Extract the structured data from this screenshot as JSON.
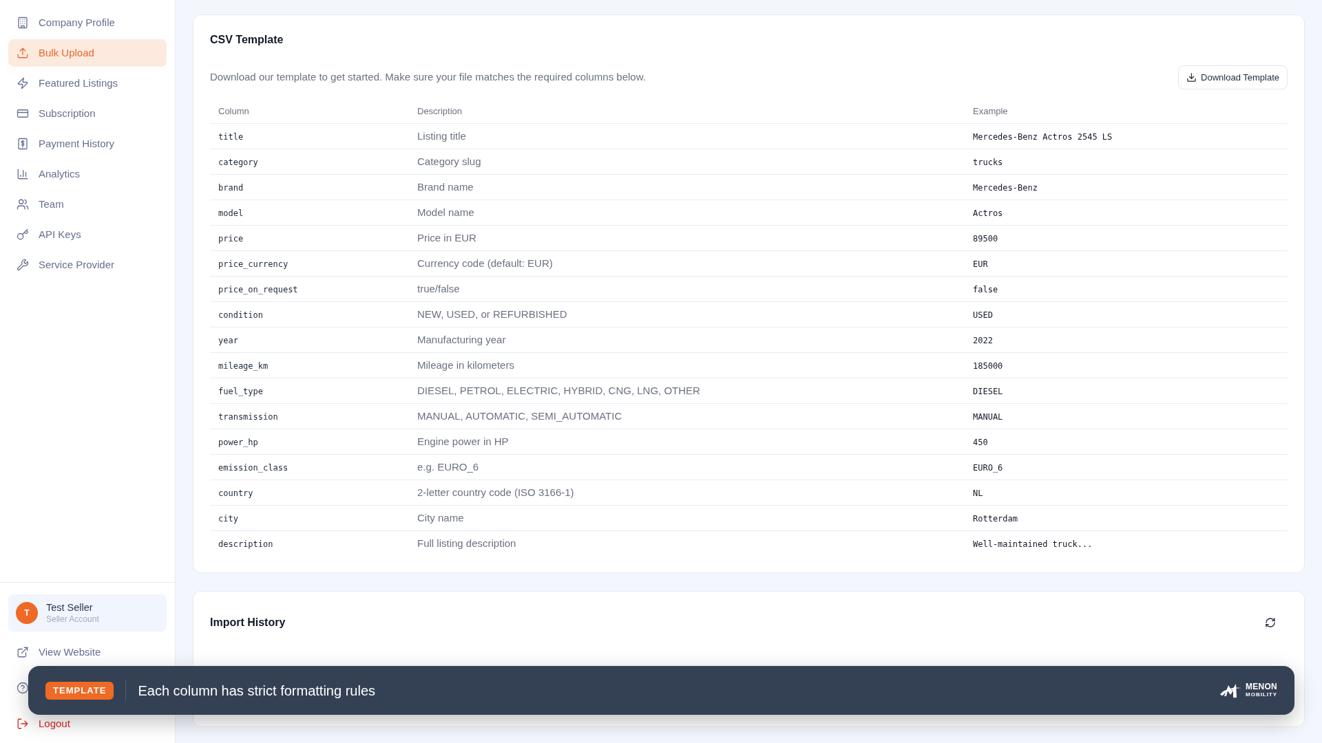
{
  "sidebar": {
    "items": [
      {
        "label": "Company Profile",
        "selected": false
      },
      {
        "label": "Bulk Upload",
        "selected": true
      },
      {
        "label": "Featured Listings",
        "selected": false
      },
      {
        "label": "Subscription",
        "selected": false
      },
      {
        "label": "Payment History",
        "selected": false
      },
      {
        "label": "Analytics",
        "selected": false
      },
      {
        "label": "Team",
        "selected": false
      },
      {
        "label": "API Keys",
        "selected": false
      },
      {
        "label": "Service Provider",
        "selected": false
      }
    ],
    "user": {
      "initial": "T",
      "name": "Test Seller",
      "role": "Seller Account"
    },
    "footer_items": [
      {
        "label": "View Website",
        "kind": "link"
      },
      {
        "kind": "covered"
      },
      {
        "label": "Logout",
        "kind": "danger"
      }
    ]
  },
  "csv_template": {
    "title": "CSV Template",
    "description": "Download our template to get started. Make sure your file matches the required columns below.",
    "download_button": "Download Template",
    "table": {
      "columns": [
        "Column",
        "Description",
        "Example"
      ],
      "rows": [
        {
          "column": "title",
          "description": "Listing title",
          "example": "Mercedes-Benz Actros 2545 LS"
        },
        {
          "column": "category",
          "description": "Category slug",
          "example": "trucks"
        },
        {
          "column": "brand",
          "description": "Brand name",
          "example": "Mercedes-Benz"
        },
        {
          "column": "model",
          "description": "Model name",
          "example": "Actros"
        },
        {
          "column": "price",
          "description": "Price in EUR",
          "example": "89500"
        },
        {
          "column": "price_currency",
          "description": "Currency code (default: EUR)",
          "example": "EUR"
        },
        {
          "column": "price_on_request",
          "description": "true/false",
          "example": "false"
        },
        {
          "column": "condition",
          "description": "NEW, USED, or REFURBISHED",
          "example": "USED"
        },
        {
          "column": "year",
          "description": "Manufacturing year",
          "example": "2022"
        },
        {
          "column": "mileage_km",
          "description": "Mileage in kilometers",
          "example": "185000"
        },
        {
          "column": "fuel_type",
          "description": "DIESEL, PETROL, ELECTRIC, HYBRID, CNG, LNG, OTHER",
          "example": "DIESEL"
        },
        {
          "column": "transmission",
          "description": "MANUAL, AUTOMATIC, SEMI_AUTOMATIC",
          "example": "MANUAL"
        },
        {
          "column": "power_hp",
          "description": "Engine power in HP",
          "example": "450"
        },
        {
          "column": "emission_class",
          "description": "e.g. EURO_6",
          "example": "EURO_6"
        },
        {
          "column": "country",
          "description": "2-letter country code (ISO 3166-1)",
          "example": "NL"
        },
        {
          "column": "city",
          "description": "City name",
          "example": "Rotterdam"
        },
        {
          "column": "description",
          "description": "Full listing description",
          "example": "Well-maintained truck..."
        }
      ]
    }
  },
  "import_history": {
    "title": "Import History"
  },
  "toast": {
    "tag": "TEMPLATE",
    "message": "Each column has strict formatting rules",
    "logo": {
      "name": "MENON",
      "tagline": "MOBILITY"
    }
  }
}
